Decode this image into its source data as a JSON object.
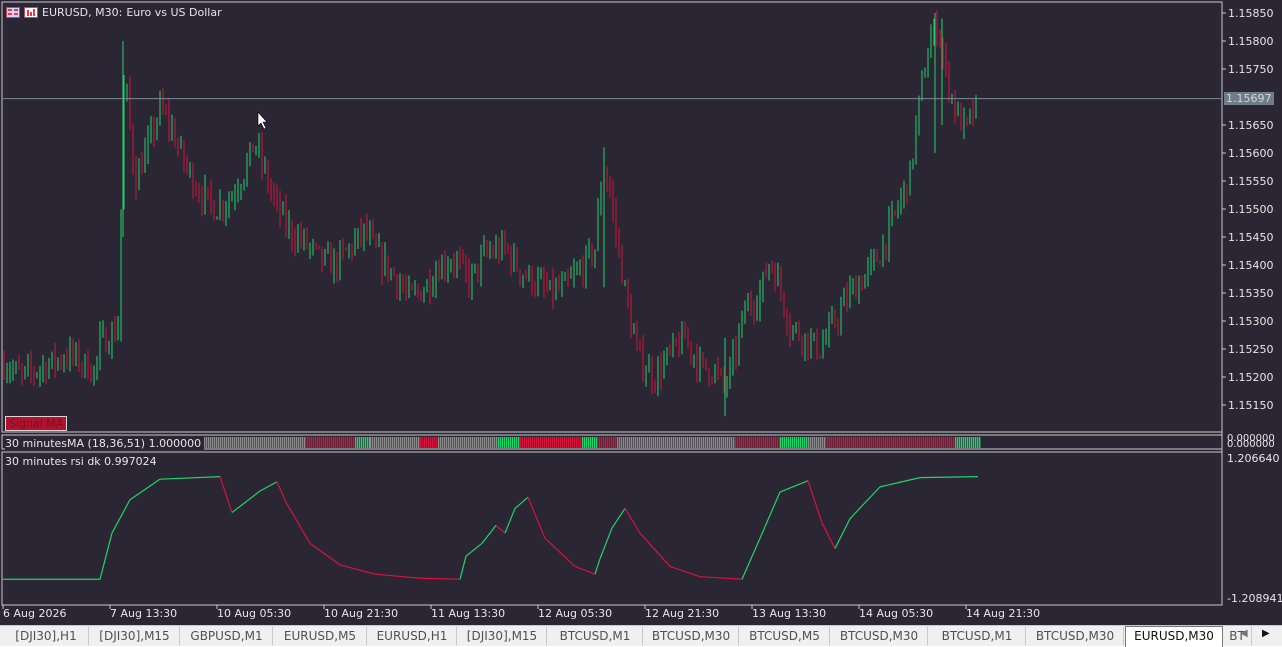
{
  "header": {
    "symbol": "EURUSD, M30:",
    "description": "Euro vs US Dollar"
  },
  "price_axis": {
    "labels": [
      "1.15850",
      "1.15800",
      "1.15750",
      "1.15650",
      "1.15600",
      "1.15550",
      "1.15500",
      "1.15450",
      "1.15400",
      "1.15350",
      "1.15300",
      "1.15250",
      "1.15200",
      "1.15150"
    ],
    "values": [
      1.1585,
      1.158,
      1.1575,
      1.1565,
      1.156,
      1.1555,
      1.155,
      1.1545,
      1.154,
      1.1535,
      1.153,
      1.1525,
      1.152,
      1.1515
    ],
    "top_value": "1.15850",
    "bottom_value": "1.15150"
  },
  "current_price": {
    "label": "1.15697",
    "value": 1.15697
  },
  "signal_label": "Signal  MA",
  "ma_indicator": {
    "label": "30 minutesMA  (18,36,51) 1.000000",
    "scale_top": "0.000000",
    "scale_bottom": "0.000000"
  },
  "rsi_indicator": {
    "label": "30 minutes rsi dk  0.997024",
    "scale_top": "1.206640",
    "scale_bottom": "-1.208941"
  },
  "time_axis": [
    "6 Aug 2026",
    "7 Aug 13:30",
    "10 Aug 05:30",
    "10 Aug 21:30",
    "11 Aug 13:30",
    "12 Aug 05:30",
    "12 Aug 21:30",
    "13 Aug 13:30",
    "14 Aug 05:30",
    "14 Aug 21:30"
  ],
  "tabs": [
    {
      "label": "[DJI30],H1",
      "active": false
    },
    {
      "label": "[DJI30],M15",
      "active": false
    },
    {
      "label": "GBPUSD,M1",
      "active": false
    },
    {
      "label": "EURUSD,M5",
      "active": false
    },
    {
      "label": "EURUSD,H1",
      "active": false
    },
    {
      "label": "[DJI30],M15",
      "active": false
    },
    {
      "label": "BTCUSD,M1",
      "active": false
    },
    {
      "label": "BTCUSD,M30",
      "active": false
    },
    {
      "label": "BTCUSD,M5",
      "active": false
    },
    {
      "label": "BTCUSD,M30",
      "active": false
    },
    {
      "label": "BTCUSD,M1",
      "active": false
    },
    {
      "label": "BTCUSD,M30",
      "active": false
    },
    {
      "label": "EURUSD,M30",
      "active": true
    },
    {
      "label": "BT",
      "active": false
    }
  ],
  "colors": {
    "background": "#2a2633",
    "bull": "#1fd46a",
    "bear": "#d4143c",
    "neutral_bar": "#8c8c8c",
    "grid_text": "#e6e6e6",
    "price_line": "#7d8a96"
  },
  "chart_data": {
    "type": "candlestick",
    "symbol": "EURUSD",
    "timeframe": "M30",
    "ylim": [
      1.1512,
      1.1587
    ],
    "price_path": [
      [
        0,
        1.1523
      ],
      [
        22,
        1.152
      ],
      [
        45,
        1.1522
      ],
      [
        70,
        1.1524
      ],
      [
        95,
        1.1521
      ],
      [
        100,
        1.1526
      ],
      [
        115,
        1.1528
      ],
      [
        120,
        1.153
      ],
      [
        122,
        1.157
      ],
      [
        126,
        1.1572
      ],
      [
        135,
        1.1555
      ],
      [
        150,
        1.1562
      ],
      [
        160,
        1.1568
      ],
      [
        170,
        1.1565
      ],
      [
        185,
        1.1558
      ],
      [
        200,
        1.1553
      ],
      [
        215,
        1.155
      ],
      [
        230,
        1.1552
      ],
      [
        245,
        1.1557
      ],
      [
        255,
        1.1562
      ],
      [
        262,
        1.1558
      ],
      [
        275,
        1.1551
      ],
      [
        290,
        1.1546
      ],
      [
        305,
        1.1544
      ],
      [
        320,
        1.1541
      ],
      [
        335,
        1.154
      ],
      [
        350,
        1.1543
      ],
      [
        365,
        1.1546
      ],
      [
        380,
        1.1541
      ],
      [
        395,
        1.1538
      ],
      [
        410,
        1.1534
      ],
      [
        425,
        1.1536
      ],
      [
        440,
        1.154
      ],
      [
        455,
        1.1541
      ],
      [
        470,
        1.1537
      ],
      [
        485,
        1.1542
      ],
      [
        505,
        1.1543
      ],
      [
        520,
        1.1539
      ],
      [
        535,
        1.1537
      ],
      [
        550,
        1.1535
      ],
      [
        565,
        1.1536
      ],
      [
        580,
        1.1539
      ],
      [
        595,
        1.1543
      ],
      [
        603,
        1.1558
      ],
      [
        610,
        1.1553
      ],
      [
        620,
        1.1541
      ],
      [
        630,
        1.153
      ],
      [
        640,
        1.1523
      ],
      [
        655,
        1.152
      ],
      [
        670,
        1.1524
      ],
      [
        685,
        1.1527
      ],
      [
        700,
        1.1522
      ],
      [
        715,
        1.1521
      ],
      [
        725,
        1.1518
      ],
      [
        735,
        1.1524
      ],
      [
        745,
        1.1532
      ],
      [
        760,
        1.1535
      ],
      [
        770,
        1.1541
      ],
      [
        780,
        1.1536
      ],
      [
        790,
        1.1529
      ],
      [
        805,
        1.1527
      ],
      [
        820,
        1.1525
      ],
      [
        835,
        1.153
      ],
      [
        850,
        1.1535
      ],
      [
        865,
        1.1538
      ],
      [
        880,
        1.1542
      ],
      [
        895,
        1.1549
      ],
      [
        910,
        1.1556
      ],
      [
        920,
        1.157
      ],
      [
        930,
        1.158
      ],
      [
        938,
        1.1583
      ],
      [
        945,
        1.1575
      ],
      [
        955,
        1.1568
      ],
      [
        965,
        1.1564
      ],
      [
        978,
        1.1569
      ]
    ],
    "ma_blocks": [
      [
        180,
        "neutral"
      ],
      [
        305,
        "bear"
      ],
      [
        355,
        "bull"
      ],
      [
        370,
        "neutral"
      ],
      [
        420,
        "bear"
      ],
      [
        438,
        "neutral"
      ],
      [
        498,
        "bull"
      ],
      [
        520,
        "bear"
      ],
      [
        582,
        "bull"
      ],
      [
        597,
        "bear"
      ],
      [
        617,
        "neutral"
      ],
      [
        735,
        "bear"
      ],
      [
        780,
        "bull"
      ],
      [
        808,
        "neutral"
      ],
      [
        825,
        "bear"
      ],
      [
        955,
        "bull"
      ],
      [
        980,
        "neutral"
      ]
    ],
    "rsi_series": [
      [
        3,
        -1.0
      ],
      [
        100,
        -1.0
      ],
      [
        112,
        -0.1
      ],
      [
        130,
        0.55
      ],
      [
        160,
        0.95
      ],
      [
        220,
        1.0
      ],
      [
        232,
        0.3
      ],
      [
        260,
        0.72
      ],
      [
        277,
        0.9
      ],
      [
        286,
        0.5
      ],
      [
        310,
        -0.3
      ],
      [
        340,
        -0.72
      ],
      [
        375,
        -0.9
      ],
      [
        420,
        -0.98
      ],
      [
        460,
        -1.0
      ],
      [
        466,
        -0.55
      ],
      [
        482,
        -0.3
      ],
      [
        496,
        0.05
      ],
      [
        505,
        -0.1
      ],
      [
        515,
        0.38
      ],
      [
        528,
        0.6
      ],
      [
        545,
        -0.2
      ],
      [
        575,
        -0.75
      ],
      [
        595,
        -0.9
      ],
      [
        600,
        -0.6
      ],
      [
        612,
        0.0
      ],
      [
        625,
        0.38
      ],
      [
        640,
        -0.1
      ],
      [
        670,
        -0.75
      ],
      [
        700,
        -0.95
      ],
      [
        742,
        -1.0
      ],
      [
        760,
        -0.2
      ],
      [
        780,
        0.7
      ],
      [
        808,
        0.92
      ],
      [
        822,
        0.1
      ],
      [
        835,
        -0.4
      ],
      [
        850,
        0.18
      ],
      [
        880,
        0.8
      ],
      [
        920,
        0.98
      ],
      [
        978,
        1.0
      ]
    ]
  }
}
